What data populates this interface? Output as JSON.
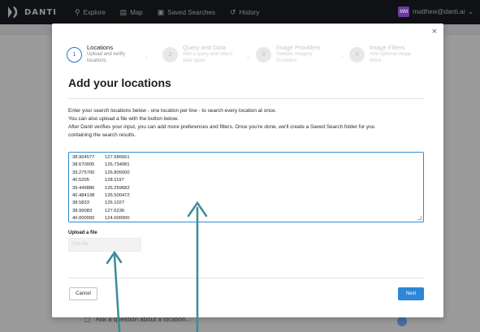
{
  "nav": {
    "logo_text": "DANTI",
    "items": [
      {
        "icon": "search-icon",
        "glyph": "⚲",
        "label": "Explore"
      },
      {
        "icon": "map-icon",
        "glyph": "▤",
        "label": "Map"
      },
      {
        "icon": "saved-searches-icon",
        "glyph": "▣",
        "label": "Saved Searches"
      },
      {
        "icon": "history-icon",
        "glyph": "↺",
        "label": "History"
      }
    ],
    "avatar_initials": "MM",
    "user_email": "matthew@danti.ai"
  },
  "modal": {
    "close_glyph": "×",
    "steps": [
      {
        "number": "1",
        "title": "Locations",
        "subtitle_1": "Upload and verify",
        "subtitle_2": "locations",
        "state": "active"
      },
      {
        "number": "2",
        "title": "Query and Data",
        "subtitle_1": "Add a query and select",
        "subtitle_2": "data types",
        "state": "inactive"
      },
      {
        "number": "3",
        "title": "Image Providers",
        "subtitle_1": "Satellite Imagery",
        "subtitle_2": "Providers",
        "state": "inactive"
      },
      {
        "number": "4",
        "title": "Image Filters",
        "subtitle_1": "Add optional image",
        "subtitle_2": "filters",
        "state": "inactive"
      }
    ],
    "title": "Add your locations",
    "instructions": [
      "Enter your search locations below - one location per line - to search every location at once.",
      "You can also upload a file with the button below.",
      "After Danti verifies your input, you can add more preferences and filters. Once you're done, we'll create a Saved Search folder for you",
      "containing the search results."
    ],
    "coordinates": [
      {
        "lat": "38.964577",
        "lon": "127.586661"
      },
      {
        "lat": "38.670005",
        "lon": "126.734081"
      },
      {
        "lat": "39.275700",
        "lon": "126.805000"
      },
      {
        "lat": "40.5205",
        "lon": "128.1197"
      },
      {
        "lat": "39.449886",
        "lon": "126.259682"
      },
      {
        "lat": "40.484138",
        "lon": "126.500472"
      },
      {
        "lat": "38.5833",
        "lon": "126.1027"
      },
      {
        "lat": "38.99083",
        "lon": "127.6236"
      },
      {
        "lat": "40.000000",
        "lon": "124.000000"
      }
    ],
    "upload_label": "Upload a file",
    "upload_placeholder": "Pick file",
    "cancel_label": "Cancel",
    "next_label": "Next"
  },
  "background": {
    "row_text": "Ask a question about a location..."
  },
  "colors": {
    "accent": "#2d86d6",
    "active_step": "#2d6bc7",
    "nav_bg": "#0f1114",
    "overlay_bg": "#9a9a9a",
    "arrow": "#3c8c99"
  }
}
